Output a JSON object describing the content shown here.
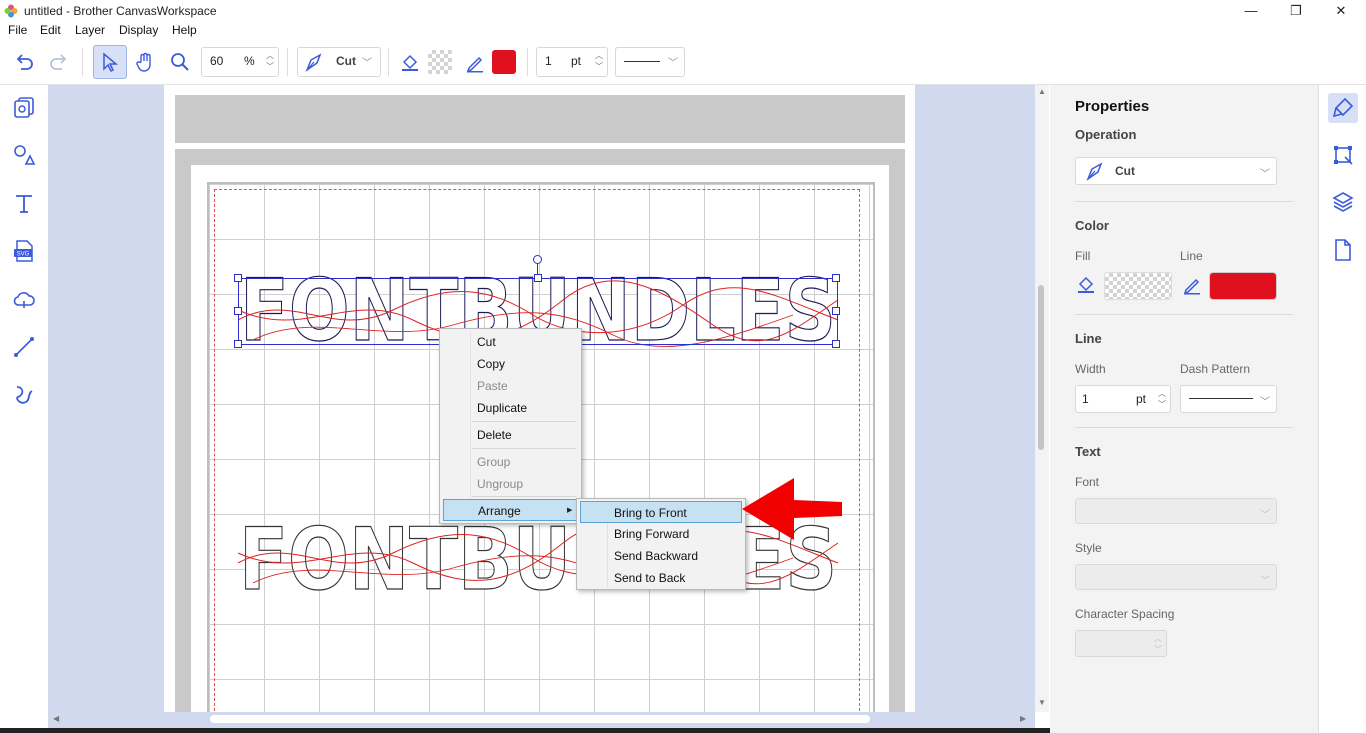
{
  "window": {
    "title": "untitled - Brother CanvasWorkspace"
  },
  "menubar": [
    "File",
    "Edit",
    "Layer",
    "Display",
    "Help"
  ],
  "toolbar": {
    "zoom_value": "60",
    "zoom_unit": "%",
    "operation": "Cut",
    "line_color": "#e0101e",
    "line_width": "1",
    "line_width_unit": "pt"
  },
  "canvas": {
    "text_top": "FONTBUNDLES",
    "text_bottom": "FONTBUNDLES"
  },
  "context_menu": {
    "items": [
      {
        "label": "Cut",
        "enabled": true
      },
      {
        "label": "Copy",
        "enabled": true
      },
      {
        "label": "Paste",
        "enabled": false
      },
      {
        "label": "Duplicate",
        "enabled": true
      },
      {
        "label": "Delete",
        "enabled": true
      },
      {
        "label": "Group",
        "enabled": false
      },
      {
        "label": "Ungroup",
        "enabled": false
      },
      {
        "label": "Arrange",
        "enabled": true,
        "highlighted": true
      }
    ],
    "submenu": [
      {
        "label": "Bring to Front",
        "highlighted": true
      },
      {
        "label": "Bring Forward"
      },
      {
        "label": "Send Backward"
      },
      {
        "label": "Send to Back"
      }
    ]
  },
  "properties": {
    "title": "Properties",
    "operation_label": "Operation",
    "operation_value": "Cut",
    "color_label": "Color",
    "fill_label": "Fill",
    "line_label": "Line",
    "line_color": "#e0101e",
    "line_section": "Line",
    "width_label": "Width",
    "width_value": "1",
    "width_unit": "pt",
    "dash_label": "Dash Pattern",
    "text_section": "Text",
    "font_label": "Font",
    "style_label": "Style",
    "char_spacing_label": "Character Spacing"
  },
  "annotation": {
    "arrow_color": "#f00000"
  }
}
